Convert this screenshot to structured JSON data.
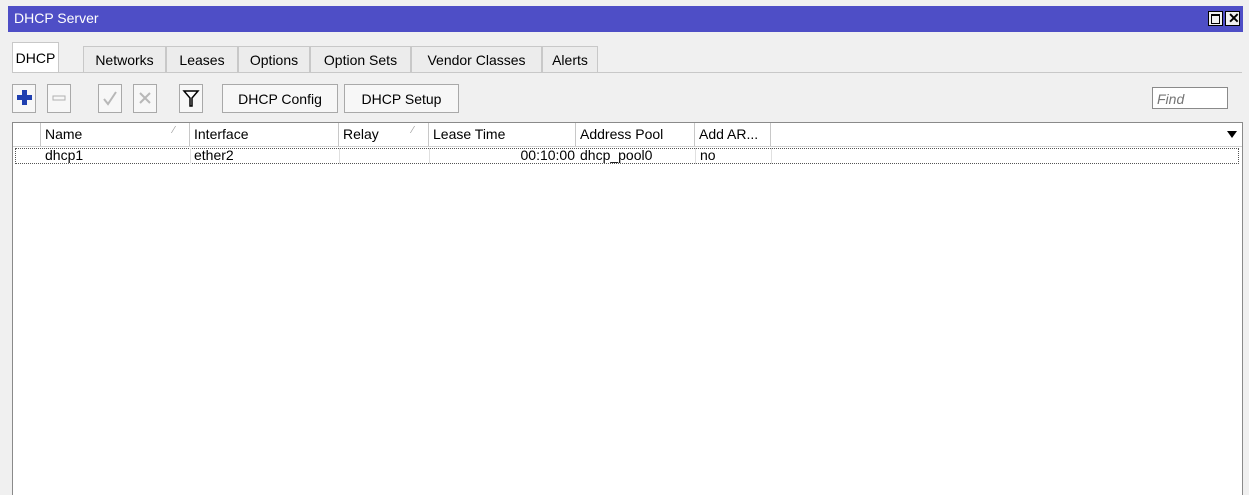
{
  "window": {
    "title": "DHCP Server"
  },
  "tabs": [
    "DHCP",
    "Networks",
    "Leases",
    "Options",
    "Option Sets",
    "Vendor Classes",
    "Alerts"
  ],
  "toolbar": {
    "dhcp_config_label": "DHCP Config",
    "dhcp_setup_label": "DHCP Setup",
    "find_placeholder": "Find"
  },
  "table": {
    "columns": [
      "Name",
      "Interface",
      "Relay",
      "Lease Time",
      "Address Pool",
      "Add AR..."
    ],
    "rows": [
      {
        "name": "dhcp1",
        "interface": "ether2",
        "relay": "",
        "lease_time": "00:10:00",
        "address_pool": "dhcp_pool0",
        "add_arp": "no"
      }
    ]
  },
  "colors": {
    "titlebar": "#4e4ec6",
    "add_icon": "#1f3fb0"
  }
}
